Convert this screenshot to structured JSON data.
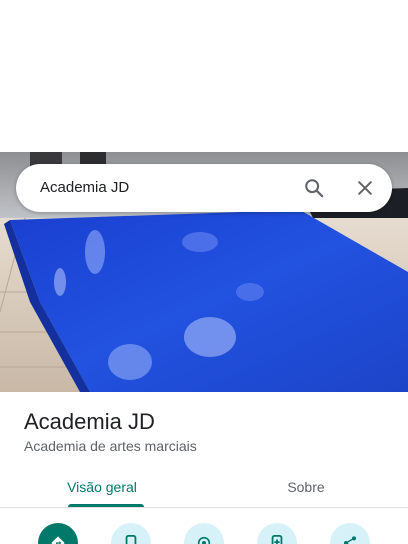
{
  "search": {
    "query": "Academia JD",
    "search_icon": "search-icon",
    "close_icon": "close-icon"
  },
  "place": {
    "name": "Academia JD",
    "category": "Academia de artes marciais"
  },
  "tabs": [
    {
      "label": "Visão geral",
      "selected": true
    },
    {
      "label": "Sobre",
      "selected": false
    }
  ],
  "actions": [
    {
      "icon": "directions-icon",
      "primary": true
    },
    {
      "icon": "phone-icon",
      "primary": false
    },
    {
      "icon": "location-icon",
      "primary": false
    },
    {
      "icon": "add-to-phone-icon",
      "primary": false
    },
    {
      "icon": "share-icon",
      "primary": false
    }
  ],
  "colors": {
    "accent": "#00796b",
    "action_bg": "#d6f2f8",
    "mat_blue": "#1f48d6"
  }
}
